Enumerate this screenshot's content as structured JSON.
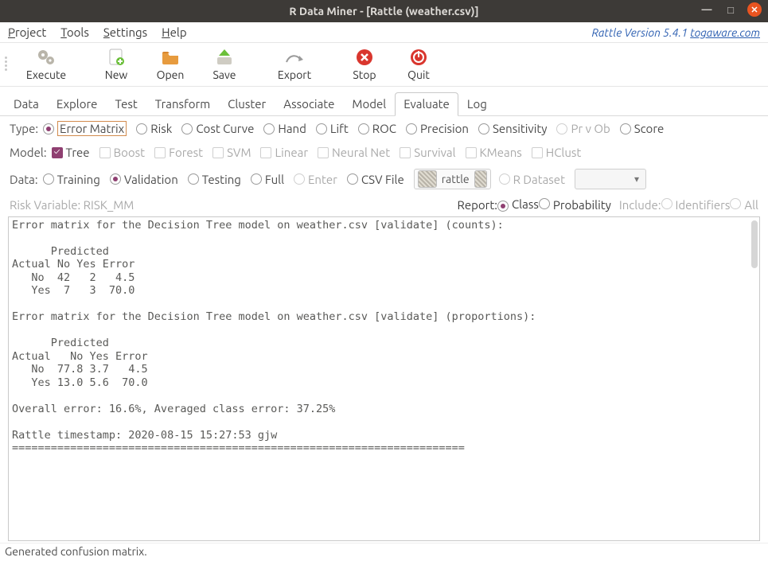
{
  "title": "R Data Miner - [Rattle (weather.csv)]",
  "menu": {
    "project": "Project",
    "tools": "Tools",
    "settings": "Settings",
    "help": "Help"
  },
  "version": {
    "text": "Rattle Version 5.4.1 ",
    "link": "togaware.com"
  },
  "toolbar": {
    "execute": "Execute",
    "new": "New",
    "open": "Open",
    "save": "Save",
    "export": "Export",
    "stop": "Stop",
    "quit": "Quit"
  },
  "tabs": [
    "Data",
    "Explore",
    "Test",
    "Transform",
    "Cluster",
    "Associate",
    "Model",
    "Evaluate",
    "Log"
  ],
  "active_tab": "Evaluate",
  "type": {
    "label": "Type:",
    "options": [
      "Error Matrix",
      "Risk",
      "Cost Curve",
      "Hand",
      "Lift",
      "ROC",
      "Precision",
      "Sensitivity",
      "Pr v Ob",
      "Score"
    ],
    "selected": "Error Matrix"
  },
  "model": {
    "label": "Model:",
    "options": [
      "Tree",
      "Boost",
      "Forest",
      "SVM",
      "Linear",
      "Neural Net",
      "Survival",
      "KMeans",
      "HClust"
    ],
    "checked": [
      "Tree"
    ]
  },
  "data_row": {
    "label": "Data:",
    "options": [
      "Training",
      "Validation",
      "Testing",
      "Full",
      "Enter",
      "CSV File"
    ],
    "selected": "Validation",
    "filebox": "rattle",
    "rdataset": "R Dataset"
  },
  "risk": {
    "label": "Risk Variable: ",
    "value": "RISK_MM"
  },
  "report": {
    "label": "Report:",
    "options": [
      "Class",
      "Probability"
    ],
    "selected": "Class"
  },
  "include": {
    "label": "Include:",
    "options": [
      "Identifiers",
      "All"
    ]
  },
  "output": "Error matrix for the Decision Tree model on weather.csv [validate] (counts):\n\n      Predicted\nActual No Yes Error\n   No  42   2   4.5\n   Yes  7   3  70.0\n\nError matrix for the Decision Tree model on weather.csv [validate] (proportions):\n\n      Predicted\nActual   No Yes Error\n   No  77.8 3.7   4.5\n   Yes 13.0 5.6  70.0\n\nOverall error: 16.6%, Averaged class error: 37.25%\n\nRattle timestamp: 2020-08-15 15:27:53 gjw\n======================================================================",
  "status": "Generated confusion matrix."
}
